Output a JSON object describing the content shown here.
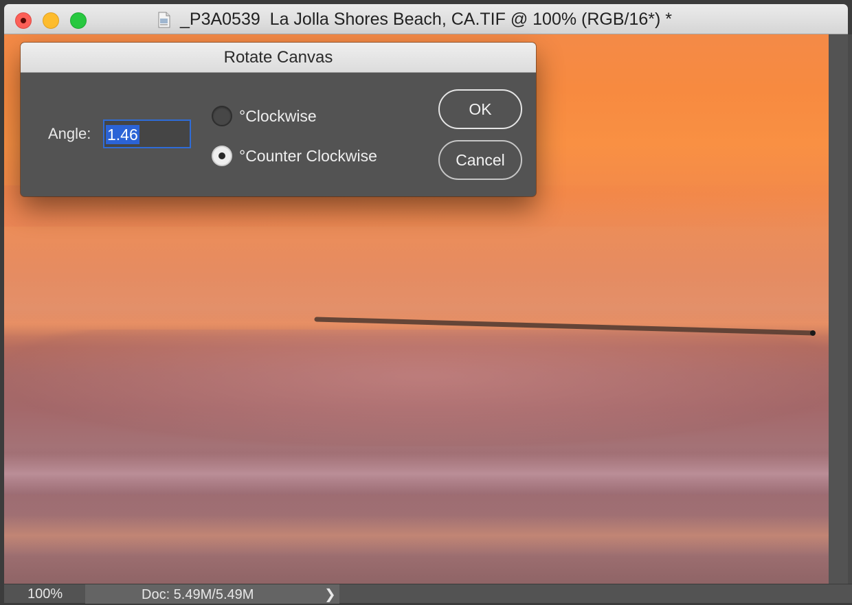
{
  "window": {
    "title": "_P3A0539  La Jolla Shores Beach, CA.TIF @ 100% (RGB/16*) *",
    "traffic_lights": [
      "close",
      "minimize",
      "zoom"
    ],
    "doc_icon": "document-icon"
  },
  "dialog": {
    "title": "Rotate Canvas",
    "angle_label": "Angle:",
    "angle_value": "1.46",
    "options": [
      {
        "label": "°Clockwise",
        "selected": false
      },
      {
        "label": "°Counter Clockwise",
        "selected": true
      }
    ],
    "ok_label": "OK",
    "cancel_label": "Cancel"
  },
  "status_bar": {
    "zoom": "100%",
    "doc_info": "Doc: 5.49M/5.49M",
    "arrow": "❯"
  },
  "colors": {
    "accent": "#2b63d6",
    "dialog_bg": "#535353",
    "sky": "#f78a40"
  }
}
